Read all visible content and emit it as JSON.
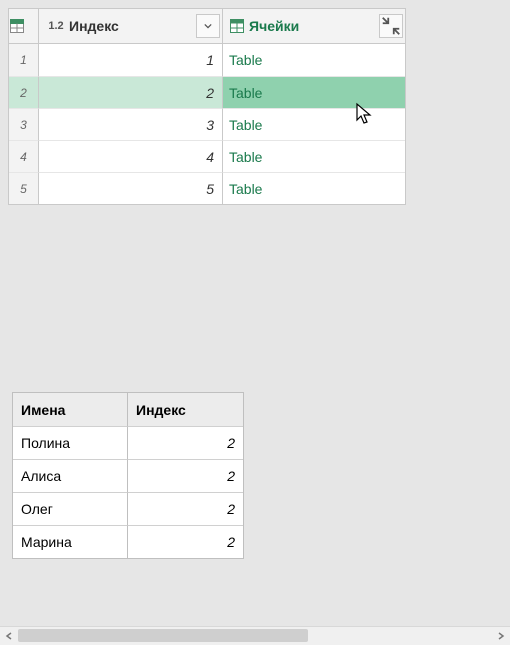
{
  "top": {
    "columns": {
      "index": {
        "type_label": "1.2",
        "label": "Индекс"
      },
      "cells": {
        "label": "Ячейки"
      }
    },
    "rows": [
      {
        "n": "1",
        "index": "1",
        "cell": "Table",
        "selected": false
      },
      {
        "n": "2",
        "index": "2",
        "cell": "Table",
        "selected": true
      },
      {
        "n": "3",
        "index": "3",
        "cell": "Table",
        "selected": false
      },
      {
        "n": "4",
        "index": "4",
        "cell": "Table",
        "selected": false
      },
      {
        "n": "5",
        "index": "5",
        "cell": "Table",
        "selected": false
      }
    ]
  },
  "bottom": {
    "headers": {
      "name": "Имена",
      "index": "Индекс"
    },
    "rows": [
      {
        "name": "Полина",
        "index": "2"
      },
      {
        "name": "Алиса",
        "index": "2"
      },
      {
        "name": "Олег",
        "index": "2"
      },
      {
        "name": "Марина",
        "index": "2"
      }
    ]
  }
}
